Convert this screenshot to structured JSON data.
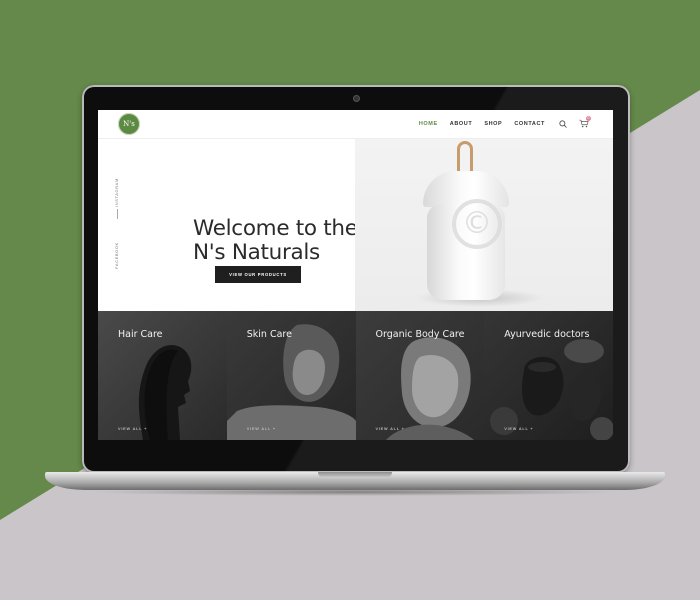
{
  "brand": {
    "logo_text": "N's",
    "accent_color": "#5d8a43",
    "background_green": "#64894a",
    "background_gray": "#c9c5c8"
  },
  "nav": {
    "items": [
      {
        "label": "HOME",
        "active": true
      },
      {
        "label": "ABOUT",
        "active": false
      },
      {
        "label": "SHOP",
        "active": false
      },
      {
        "label": "CONTACT",
        "active": false
      }
    ],
    "search_icon": "search-icon",
    "cart_icon": "cart-icon",
    "cart_count": "0"
  },
  "social": {
    "facebook": "FACEBOOK",
    "instagram": "INSTAGRAM"
  },
  "hero": {
    "title_line1": "Welcome to the",
    "title_line2": "N's Naturals",
    "button_label": "VIEW OUR PRODUCTS",
    "watermark": "©"
  },
  "categories": [
    {
      "title": "Hair Care",
      "link": "VIEW ALL +"
    },
    {
      "title": "Skin Care",
      "link": "VIEW ALL +"
    },
    {
      "title": "Organic Body Care",
      "link": "VIEW ALL +"
    },
    {
      "title": "Ayurvedic doctors",
      "link": "VIEW ALL +"
    }
  ]
}
